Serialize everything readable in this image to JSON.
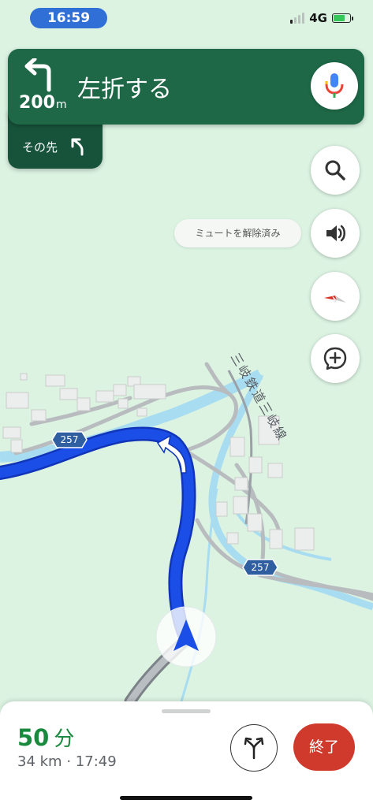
{
  "status_bar": {
    "time": "16:59",
    "network": "4G",
    "signal_bars_active": 1,
    "battery_level": 0.7,
    "battery_charging": true
  },
  "navigation": {
    "distance_value": "200",
    "distance_unit": "m",
    "instruction": "左折する",
    "turn_icon": "turn-left-icon",
    "then_label": "その先",
    "then_icon": "slight-left-icon",
    "header_color": "#1e6847"
  },
  "map_controls": {
    "search_icon": "search-icon",
    "sound_icon": "volume-icon",
    "mute_status": "ミュートを解除済み",
    "compass_icon": "compass-icon",
    "report_icon": "add-report-icon"
  },
  "map": {
    "route_shields": [
      "257",
      "257"
    ],
    "rail_line": "三岐鉄道三岐線",
    "route_color": "#1b4ee6"
  },
  "trip": {
    "duration_value": "50",
    "duration_unit": "分",
    "distance": "34 km",
    "separator": "·",
    "arrival": "17:49",
    "end_label": "終了",
    "alt_routes_icon": "alternate-routes-icon",
    "eta_color": "#198a3d",
    "end_color": "#cf3a2c"
  }
}
